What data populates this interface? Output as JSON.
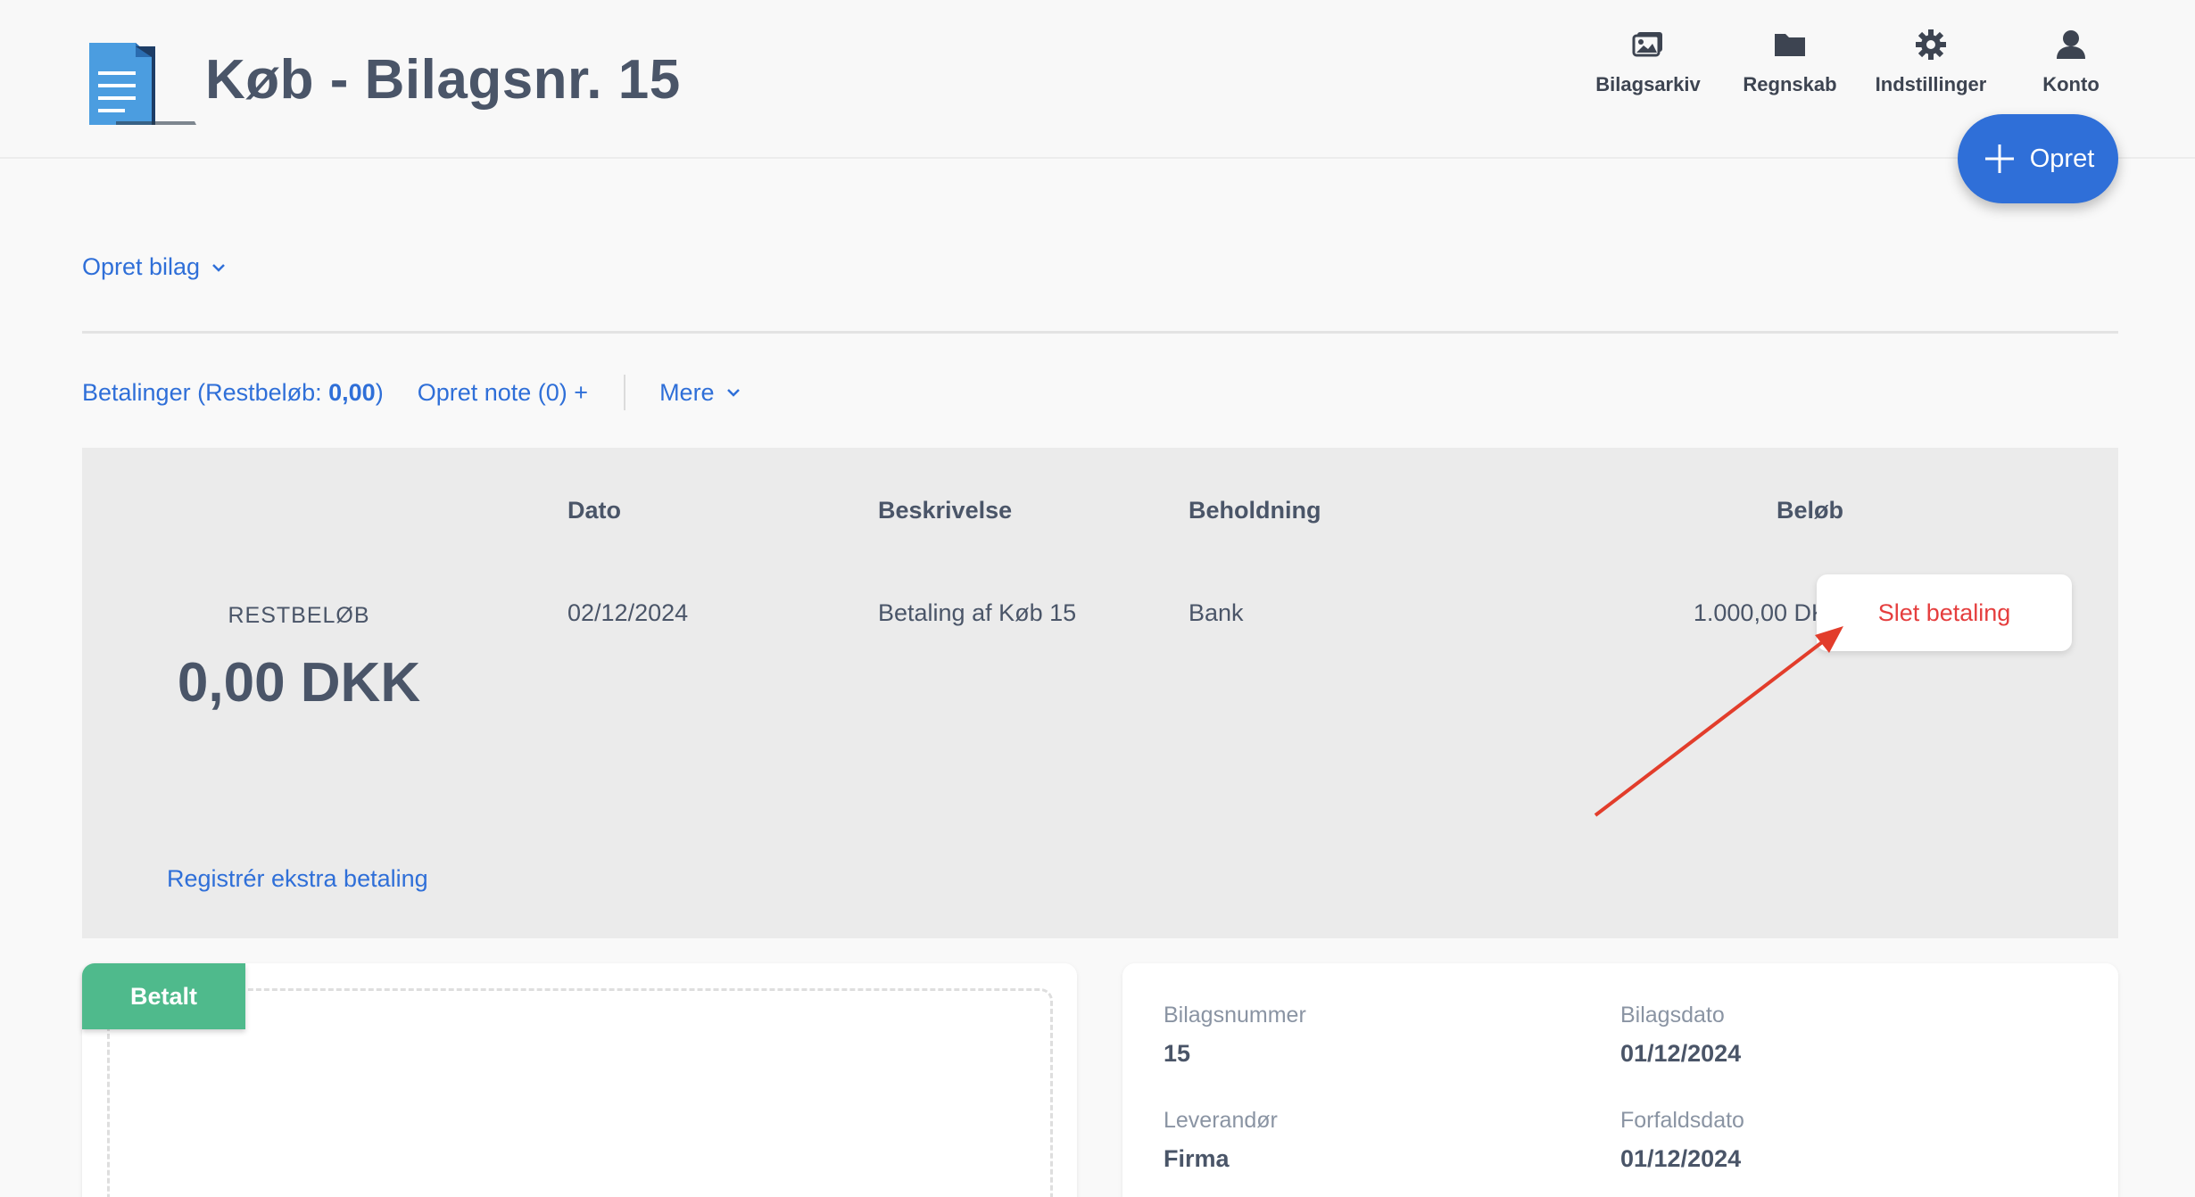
{
  "header": {
    "title": "Køb - Bilagsnr. 15",
    "nav": [
      {
        "label": "Bilagsarkiv",
        "icon": "images-icon"
      },
      {
        "label": "Regnskab",
        "icon": "folder-icon"
      },
      {
        "label": "Indstillinger",
        "icon": "gear-icon"
      },
      {
        "label": "Konto",
        "icon": "user-icon"
      }
    ],
    "opret_label": "Opret"
  },
  "toolbar": {
    "opret_bilag": "Opret bilag",
    "betalinger_prefix": "Betalinger (Restbeløb: ",
    "betalinger_amount": "0,00",
    "betalinger_suffix": ")",
    "opret_note": "Opret note (0) +",
    "mere": "Mere"
  },
  "payments": {
    "rest_label": "RESTBELØB",
    "rest_value": "0,00 DKK",
    "columns": {
      "dato": "Dato",
      "beskrivelse": "Beskrivelse",
      "beholdning": "Beholdning",
      "belob": "Beløb"
    },
    "rows": [
      {
        "dato": "02/12/2024",
        "beskrivelse": "Betaling af Køb 15",
        "beholdning": "Bank",
        "belob": "1.000,00 DKK",
        "action": "Slet betaling"
      }
    ],
    "register_extra": "Registrér ekstra betaling"
  },
  "status_badge": "Betalt",
  "details": {
    "bilagsnummer_label": "Bilagsnummer",
    "bilagsnummer": "15",
    "bilagsdato_label": "Bilagsdato",
    "bilagsdato": "01/12/2024",
    "leverandor_label": "Leverandør",
    "leverandor": "Firma",
    "forfaldsdato_label": "Forfaldsdato",
    "forfaldsdato": "01/12/2024"
  },
  "colors": {
    "accent": "#2f6fd8",
    "danger": "#e53e3e",
    "success": "#4fba8c",
    "annotation_arrow": "#e23d2b"
  }
}
